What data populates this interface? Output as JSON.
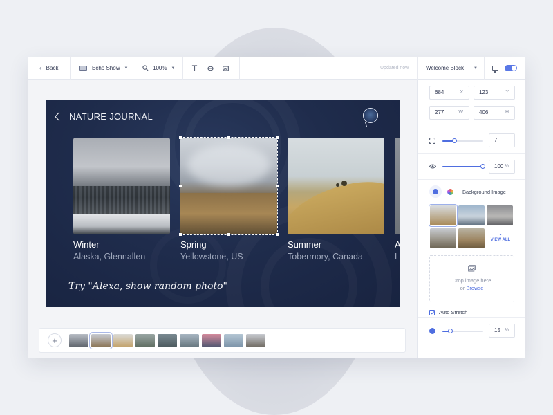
{
  "toolbar": {
    "back_label": "Back",
    "device_label": "Echo Show",
    "zoom_label": "100%",
    "status": "Updated now",
    "block_label": "Welcome Block"
  },
  "stage": {
    "title": "NATURE JOURNAL",
    "hint": "Try \"Alexa, show random photo\"",
    "cards": [
      {
        "name": "Winter",
        "place": "Alaska, Glennallen"
      },
      {
        "name": "Spring",
        "place": "Yellowstone, US"
      },
      {
        "name": "Summer",
        "place": "Tobermory, Canada"
      },
      {
        "name": "A",
        "place": "L"
      }
    ]
  },
  "panel": {
    "x": {
      "value": "684",
      "label": "X"
    },
    "y": {
      "value": "123",
      "label": "Y"
    },
    "w": {
      "value": "277",
      "label": "W"
    },
    "h": {
      "value": "406",
      "label": "H"
    },
    "corner_radius": {
      "value": "7",
      "level": 0.3
    },
    "opacity": {
      "value": "100",
      "unit": "%",
      "level": 1.0
    },
    "background_label": "Background Image",
    "view_all": "VIEW ALL",
    "drop_text": "Drop image here",
    "or_text": "or",
    "browse_text": "Browse",
    "auto_stretch": "Auto Stretch",
    "blur": {
      "value": "15",
      "unit": "%",
      "level": 0.2
    },
    "accent": "#4f6ee0"
  },
  "icons": [
    "chevron-left-icon",
    "device-icon",
    "zoom-icon",
    "text-tool-icon",
    "shape-tool-icon",
    "image-tool-icon",
    "monitor-icon",
    "toggle",
    "expand-icon",
    "eye-icon",
    "color-palette-icon",
    "image-icon",
    "plus-icon"
  ]
}
